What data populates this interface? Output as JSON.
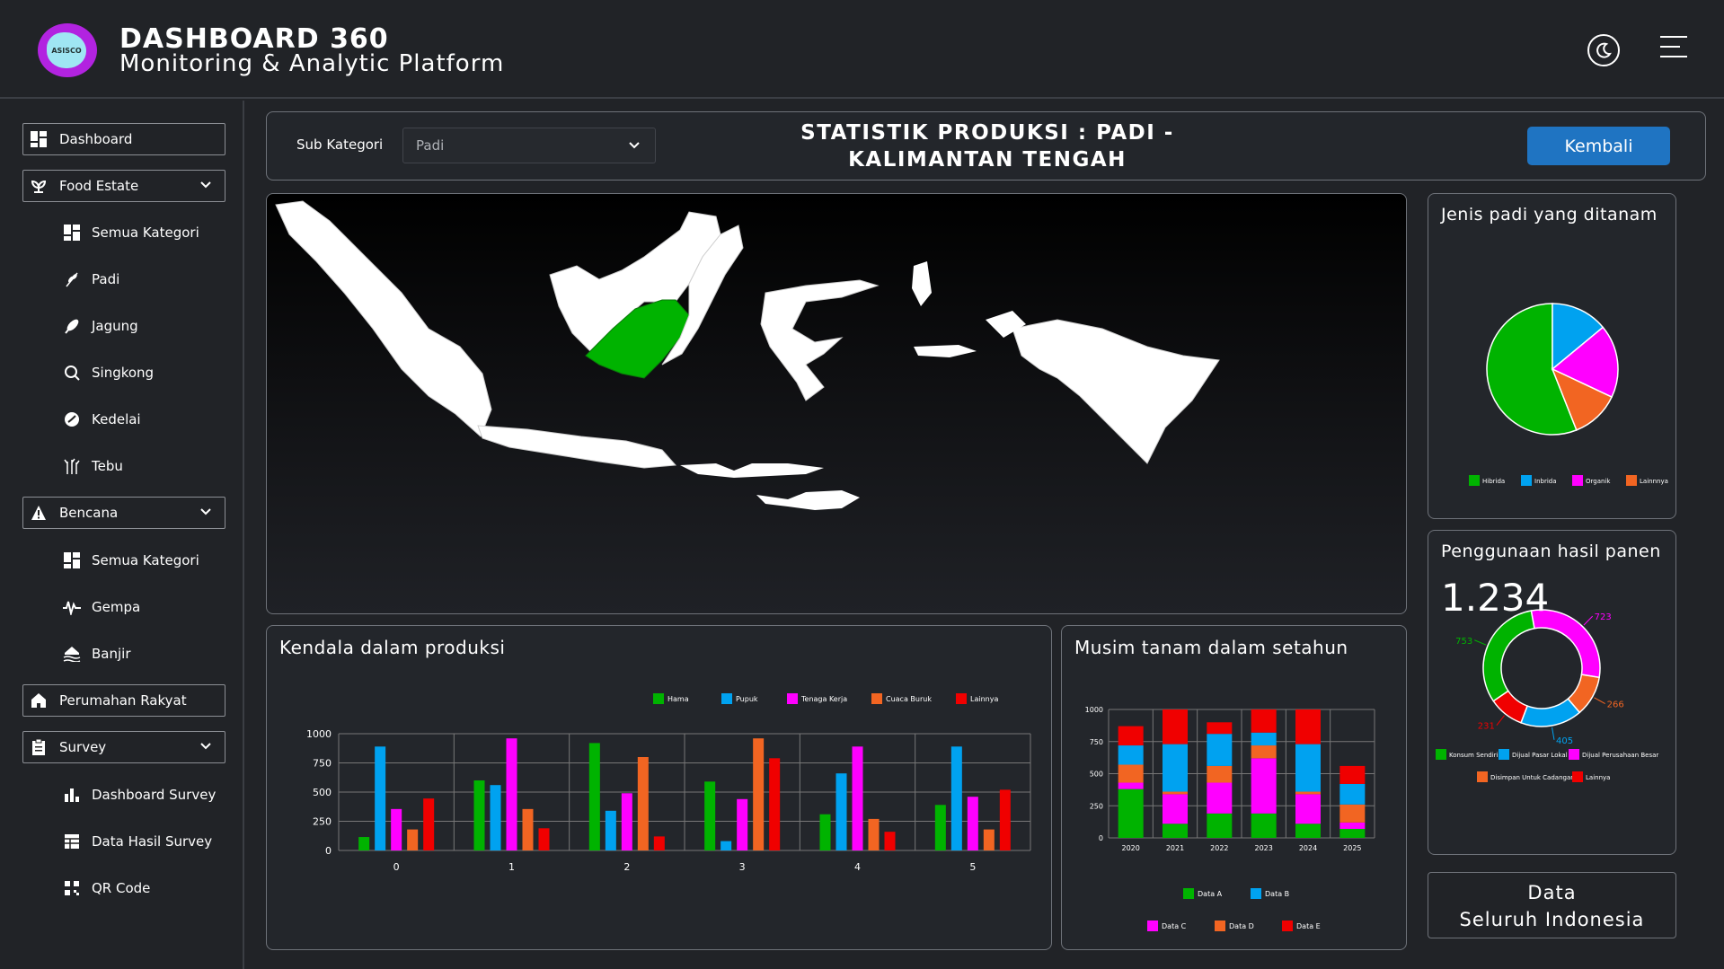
{
  "header": {
    "logo_text": "ASISCO",
    "title": "DASHBOARD 360",
    "subtitle": "Monitoring & Analytic Platform"
  },
  "sidebar": {
    "dashboard": "Dashboard",
    "food_estate": "Food Estate",
    "food_items": [
      "Semua Kategori",
      "Padi",
      "Jagung",
      "Singkong",
      "Kedelai",
      "Tebu"
    ],
    "bencana": "Bencana",
    "bencana_items": [
      "Semua Kategori",
      "Gempa",
      "Banjir"
    ],
    "perumahan": "Perumahan Rakyat",
    "survey": "Survey",
    "survey_items": [
      "Dashboard Survey",
      "Data Hasil Survey",
      "QR Code"
    ]
  },
  "filter": {
    "label": "Sub Kategori",
    "value": "Padi"
  },
  "page_title_line1": "STATISTIK PRODUKSI : PADI -",
  "page_title_line2": "KALIMANTAN TENGAH",
  "back_button": "Kembali",
  "data_all_line1": "Data",
  "data_all_line2": "Seluruh Indonesia",
  "colors": {
    "green": "#00b300",
    "blue": "#00a2f0",
    "magenta": "#ff00ff",
    "orange": "#f26522",
    "red": "#f00000",
    "accent": "#1f74c2"
  },
  "chart_data": [
    {
      "id": "kendala",
      "type": "bar",
      "title": "Kendala dalam produksi",
      "categories": [
        "0",
        "1",
        "2",
        "3",
        "4",
        "5"
      ],
      "ylim": [
        0,
        1000
      ],
      "yticks": [
        "0",
        "250",
        "500",
        "750",
        "1000"
      ],
      "legend_position": "top-right",
      "series": [
        {
          "name": "Hama",
          "color": "#00b300",
          "values": [
            115,
            600,
            920,
            590,
            310,
            390
          ]
        },
        {
          "name": "Pupuk",
          "color": "#00a2f0",
          "values": [
            890,
            560,
            340,
            80,
            660,
            890
          ]
        },
        {
          "name": "Tenaga Kerja",
          "color": "#ff00ff",
          "values": [
            355,
            960,
            490,
            440,
            890,
            460
          ]
        },
        {
          "name": "Cuaca Buruk",
          "color": "#f26522",
          "values": [
            180,
            355,
            800,
            960,
            270,
            180
          ]
        },
        {
          "name": "Lainnya",
          "color": "#f00000",
          "values": [
            445,
            190,
            120,
            790,
            160,
            520
          ]
        }
      ]
    },
    {
      "id": "musim",
      "type": "bar",
      "stacked": true,
      "title": "Musim tanam dalam setahun",
      "categories": [
        "2020",
        "2021",
        "2022",
        "2023",
        "2024",
        "2025"
      ],
      "ylim": [
        0,
        1000
      ],
      "yticks": [
        "0",
        "250",
        "500",
        "750",
        "1000"
      ],
      "legend_position": "bottom",
      "series": [
        {
          "name": "Data A",
          "color": "#00b300",
          "values": [
            380,
            110,
            190,
            190,
            110,
            70
          ]
        },
        {
          "name": "Data C",
          "color": "#ff00ff",
          "values": [
            50,
            230,
            240,
            430,
            230,
            50
          ]
        },
        {
          "name": "Data D",
          "color": "#f26522",
          "values": [
            140,
            20,
            130,
            100,
            20,
            140
          ]
        },
        {
          "name": "Data B",
          "color": "#00a2f0",
          "values": [
            150,
            370,
            250,
            100,
            370,
            160
          ]
        },
        {
          "name": "Data E",
          "color": "#f00000",
          "values": [
            150,
            270,
            90,
            180,
            270,
            140
          ]
        }
      ]
    },
    {
      "id": "jenis",
      "type": "pie",
      "title": "Jenis padi yang ditanam",
      "legend_position": "bottom",
      "slices": [
        {
          "name": "Hibrida",
          "color": "#00b300",
          "value": 56
        },
        {
          "name": "Inbrida",
          "color": "#00a2f0",
          "value": 14
        },
        {
          "name": "Organik",
          "color": "#ff00ff",
          "value": 18
        },
        {
          "name": "Lainnnya",
          "color": "#f26522",
          "value": 12
        }
      ]
    },
    {
      "id": "penggunaan",
      "type": "pie",
      "donut": true,
      "title": "Penggunaan hasil panen",
      "total_label": "1.234",
      "legend_position": "bottom",
      "slices": [
        {
          "name": "Dijual Perusahaan Besar",
          "color": "#ff00ff",
          "value": 723,
          "label": "723"
        },
        {
          "name": "Disimpan Untuk Cadangan",
          "color": "#f26522",
          "value": 266,
          "label": "266"
        },
        {
          "name": "Dijual Pasar Lokal",
          "color": "#00a2f0",
          "value": 405,
          "label": "405"
        },
        {
          "name": "Lainnya",
          "color": "#f00000",
          "value": 231,
          "label": "231"
        },
        {
          "name": "Konsum Sendiri",
          "color": "#00b300",
          "value": 753,
          "label": "753"
        }
      ]
    }
  ]
}
